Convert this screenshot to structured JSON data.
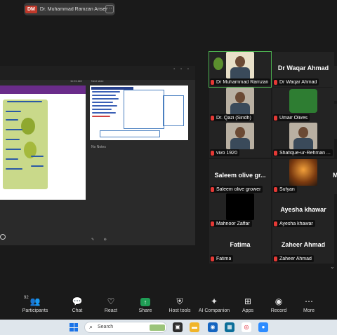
{
  "screen_share": {
    "badge": "DM",
    "name": "Dr. Muhammad Ramzan Anser P",
    "menu_icon": "ellipsis-icon"
  },
  "presenter_view": {
    "time": "11:01 AM",
    "next_slide_label": "Next slide",
    "notes": "No Notes"
  },
  "gallery": [
    {
      "id": "ramzan",
      "name": "Dr Muhammad Ramzan ...",
      "kind": "video",
      "active": true
    },
    {
      "id": "waqar",
      "name": "Dr Waqar Ahmad",
      "big_name": "Dr Waqar Ahmad",
      "kind": "name"
    },
    {
      "id": "qazi",
      "name": "Dr. Qazi (Sindh)",
      "kind": "video"
    },
    {
      "id": "umair",
      "name": "Umair Olives",
      "kind": "logo"
    },
    {
      "id": "vivo",
      "name": "vivo 1920",
      "kind": "video"
    },
    {
      "id": "shafique",
      "name": "Shafique-ur-Rehman ...",
      "kind": "video"
    },
    {
      "id": "saleem",
      "name": "Saleem olive grower",
      "big_name": "Saleem olive gr...",
      "kind": "name"
    },
    {
      "id": "sufyan",
      "name": "Sufyan",
      "kind": "image"
    },
    {
      "id": "mahnoor",
      "name": "Mahnoor Zaffar",
      "kind": "black"
    },
    {
      "id": "ayesha",
      "name": "Ayesha khawar",
      "big_name": "Ayesha khawar",
      "kind": "name"
    },
    {
      "id": "fatima",
      "name": "Fatima",
      "big_name": "Fatima",
      "kind": "name"
    },
    {
      "id": "zaheer",
      "name": "Zaheer Ahmad",
      "big_name": "Zaheer Ahmad",
      "kind": "name"
    }
  ],
  "partial_tile_letter": "M",
  "toolbar": {
    "participants_count": "92",
    "items": [
      {
        "label": "Participants",
        "icon": "participants-icon"
      },
      {
        "label": "Chat",
        "icon": "chat-icon"
      },
      {
        "label": "React",
        "icon": "react-icon"
      },
      {
        "label": "Share",
        "icon": "share-icon"
      },
      {
        "label": "Host tools",
        "icon": "shield-icon"
      },
      {
        "label": "AI Companion",
        "icon": "ai-companion-icon"
      },
      {
        "label": "Apps",
        "icon": "apps-icon"
      },
      {
        "label": "Record",
        "icon": "record-icon"
      },
      {
        "label": "More",
        "icon": "more-icon"
      }
    ]
  },
  "taskbar": {
    "search_placeholder": "Search"
  },
  "colors": {
    "active_border": "#4caf50",
    "mic_muted": "#e53935",
    "share_green": "#1f9d55",
    "taskbar": "#dfe6ec"
  }
}
